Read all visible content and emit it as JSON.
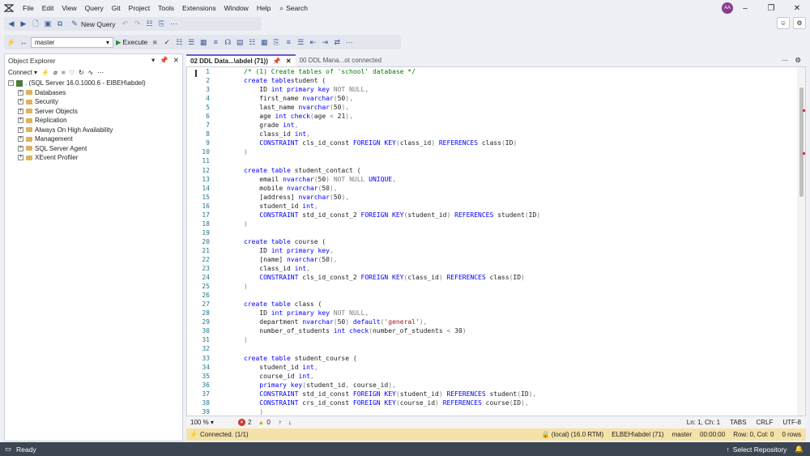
{
  "menu": [
    "File",
    "Edit",
    "View",
    "Query",
    "Git",
    "Project",
    "Tools",
    "Extensions",
    "Window",
    "Help"
  ],
  "search_label": "Search",
  "avatar_initials": "AA",
  "toolbar": {
    "new_query": "New Query",
    "database": "master",
    "execute": "Execute"
  },
  "object_explorer": {
    "title": "Object Explorer",
    "connect": "Connect",
    "server": ". (SQL Server 16.0.1000.6 - EIBEH\\abdel)",
    "nodes": [
      "Databases",
      "Security",
      "Server Objects",
      "Replication",
      "Always On High Availability",
      "Management",
      "SQL Server Agent",
      "XEvent Profiler"
    ]
  },
  "tabs": [
    {
      "label": "02 DDL Data...\\abdel (71))",
      "active": true
    },
    {
      "label": "00 DDL Mana...ot connected",
      "active": false
    }
  ],
  "code": [
    [
      [
        "cm",
        "/* (1) Create tables of 'school' database */"
      ]
    ],
    [
      [
        "kw",
        "create table"
      ],
      [
        "",
        "student ("
      ]
    ],
    [
      [
        "",
        "    ID "
      ],
      [
        "kw",
        "int primary key"
      ],
      [
        "gr",
        " NOT NULL,"
      ]
    ],
    [
      [
        "",
        "    first_name "
      ],
      [
        "kw",
        "nvarchar"
      ],
      [
        "gr",
        "("
      ],
      [
        "",
        "50"
      ],
      [
        "gr",
        "),"
      ]
    ],
    [
      [
        "",
        "    last_name "
      ],
      [
        "kw",
        "nvarchar"
      ],
      [
        "gr",
        "("
      ],
      [
        "",
        "50"
      ],
      [
        "gr",
        "),"
      ]
    ],
    [
      [
        "",
        "    age "
      ],
      [
        "kw",
        "int check"
      ],
      [
        "gr",
        "("
      ],
      [
        "",
        "age "
      ],
      [
        "gr",
        "<"
      ],
      [
        "",
        " 21"
      ],
      [
        "gr",
        "),"
      ]
    ],
    [
      [
        "",
        "    grade "
      ],
      [
        "kw",
        "int"
      ],
      [
        "gr",
        ","
      ]
    ],
    [
      [
        "",
        "    class_id "
      ],
      [
        "kw",
        "int"
      ],
      [
        "gr",
        ","
      ]
    ],
    [
      [
        "kw",
        "    CONSTRAINT"
      ],
      [
        "",
        " cls_id_const "
      ],
      [
        "kw",
        "FOREIGN KEY"
      ],
      [
        "gr",
        "("
      ],
      [
        "",
        "class_id"
      ],
      [
        "gr",
        ")"
      ],
      [
        "kw",
        " REFERENCES"
      ],
      [
        "",
        " class"
      ],
      [
        "gr",
        "("
      ],
      [
        "",
        "ID"
      ],
      [
        "gr",
        ")"
      ]
    ],
    [
      [
        "gr",
        ")"
      ]
    ],
    [
      [
        "",
        ""
      ]
    ],
    [
      [
        "kw",
        "create table"
      ],
      [
        "",
        " student_contact ("
      ]
    ],
    [
      [
        "",
        "    email "
      ],
      [
        "kw",
        "nvarchar"
      ],
      [
        "gr",
        "("
      ],
      [
        "",
        "50"
      ],
      [
        "gr",
        ")"
      ],
      [
        "gr",
        " NOT NULL"
      ],
      [
        "kw",
        " UNIQUE"
      ],
      [
        "gr",
        ","
      ]
    ],
    [
      [
        "",
        "    mobile "
      ],
      [
        "kw",
        "nvarchar"
      ],
      [
        "gr",
        "("
      ],
      [
        "",
        "50"
      ],
      [
        "gr",
        "),"
      ]
    ],
    [
      [
        "",
        "    [address] "
      ],
      [
        "kw",
        "nvarchar"
      ],
      [
        "gr",
        "("
      ],
      [
        "",
        "50"
      ],
      [
        "gr",
        "),"
      ]
    ],
    [
      [
        "",
        "    student_id "
      ],
      [
        "kw",
        "int"
      ],
      [
        "gr",
        ","
      ]
    ],
    [
      [
        "kw",
        "    CONSTRAINT"
      ],
      [
        "",
        " std_id_const_2 "
      ],
      [
        "kw",
        "FOREIGN KEY"
      ],
      [
        "gr",
        "("
      ],
      [
        "",
        "student_id"
      ],
      [
        "gr",
        ")"
      ],
      [
        "kw",
        " REFERENCES"
      ],
      [
        "",
        " student"
      ],
      [
        "gr",
        "("
      ],
      [
        "",
        "ID"
      ],
      [
        "gr",
        ")"
      ]
    ],
    [
      [
        "gr",
        ")"
      ]
    ],
    [
      [
        "",
        ""
      ]
    ],
    [
      [
        "kw",
        "create table"
      ],
      [
        "",
        " course ("
      ]
    ],
    [
      [
        "",
        "    ID "
      ],
      [
        "kw",
        "int primary key"
      ],
      [
        "gr",
        ","
      ]
    ],
    [
      [
        "",
        "    [name] "
      ],
      [
        "kw",
        "nvarchar"
      ],
      [
        "gr",
        "("
      ],
      [
        "",
        "50"
      ],
      [
        "gr",
        "),"
      ]
    ],
    [
      [
        "",
        "    class_id "
      ],
      [
        "kw",
        "int"
      ],
      [
        "gr",
        ","
      ]
    ],
    [
      [
        "kw",
        "    CONSTRAINT"
      ],
      [
        "",
        " cls_id_const_2 "
      ],
      [
        "kw",
        "FOREIGN KEY"
      ],
      [
        "gr",
        "("
      ],
      [
        "",
        "class_id"
      ],
      [
        "gr",
        ")"
      ],
      [
        "kw",
        " REFERENCES"
      ],
      [
        "",
        " class"
      ],
      [
        "gr",
        "("
      ],
      [
        "",
        "ID"
      ],
      [
        "gr",
        ")"
      ]
    ],
    [
      [
        "gr",
        ")"
      ]
    ],
    [
      [
        "",
        ""
      ]
    ],
    [
      [
        "kw",
        "create table"
      ],
      [
        "",
        " class ("
      ]
    ],
    [
      [
        "",
        "    ID "
      ],
      [
        "kw",
        "int primary key"
      ],
      [
        "gr",
        " NOT NULL,"
      ]
    ],
    [
      [
        "",
        "    department "
      ],
      [
        "kw",
        "nvarchar"
      ],
      [
        "gr",
        "("
      ],
      [
        "",
        "50"
      ],
      [
        "gr",
        ")"
      ],
      [
        "kw",
        " default"
      ],
      [
        "gr",
        "("
      ],
      [
        "str",
        "'general'"
      ],
      [
        "gr",
        "),"
      ]
    ],
    [
      [
        "",
        "    number_of_students "
      ],
      [
        "kw",
        "int check"
      ],
      [
        "gr",
        "("
      ],
      [
        "",
        "number_of_students "
      ],
      [
        "gr",
        "<"
      ],
      [
        "",
        " 30"
      ],
      [
        "gr",
        ")"
      ]
    ],
    [
      [
        "gr",
        ")"
      ]
    ],
    [
      [
        "",
        ""
      ]
    ],
    [
      [
        "kw",
        "create table"
      ],
      [
        "",
        " student_course ("
      ]
    ],
    [
      [
        "",
        "    student_id "
      ],
      [
        "kw",
        "int"
      ],
      [
        "gr",
        ","
      ]
    ],
    [
      [
        "",
        "    course_id "
      ],
      [
        "kw",
        "int"
      ],
      [
        "gr",
        ","
      ]
    ],
    [
      [
        "kw",
        "    primary key"
      ],
      [
        "gr",
        "("
      ],
      [
        "",
        "student_id"
      ],
      [
        "gr",
        ","
      ],
      [
        "",
        " course_id"
      ],
      [
        "gr",
        "),"
      ]
    ],
    [
      [
        "kw",
        "    CONSTRAINT"
      ],
      [
        "",
        " std_id_const "
      ],
      [
        "kw",
        "FOREIGN KEY"
      ],
      [
        "gr",
        "("
      ],
      [
        "",
        "student_id"
      ],
      [
        "gr",
        ")"
      ],
      [
        "kw",
        " REFERENCES"
      ],
      [
        "",
        " student"
      ],
      [
        "gr",
        "("
      ],
      [
        "",
        "ID"
      ],
      [
        "gr",
        "),"
      ]
    ],
    [
      [
        "kw",
        "    CONSTRAINT"
      ],
      [
        "",
        " crs_id_const "
      ],
      [
        "kw",
        "FOREIGN KEY"
      ],
      [
        "gr",
        "("
      ],
      [
        "",
        "course_id"
      ],
      [
        "gr",
        ")"
      ],
      [
        "kw",
        " REFERENCES"
      ],
      [
        "",
        " course"
      ],
      [
        "gr",
        "("
      ],
      [
        "",
        "ID"
      ],
      [
        "gr",
        "),"
      ]
    ],
    [
      [
        "gr",
        "    )"
      ]
    ]
  ],
  "editor_status": {
    "zoom": "100 %",
    "errors": "2",
    "warnings": "0",
    "position": "Ln: 1, Ch: 1",
    "tabs": "TABS",
    "line_ending": "CRLF",
    "encoding": "UTF-8"
  },
  "connection_bar": {
    "status": "Connected. (1/1)",
    "server": "(local) (16.0 RTM)",
    "user": "ELBEH\\abdel (71)",
    "database": "master",
    "time": "00:00:00",
    "rows_info": "Row: 0, Col: 0",
    "rows": "0 rows"
  },
  "statusbar": {
    "ready": "Ready",
    "repo": "Select Repository"
  },
  "colors": {
    "accent": "#6a5acd",
    "statusbar": "#3c4652",
    "connbar": "#f5e2a8"
  }
}
